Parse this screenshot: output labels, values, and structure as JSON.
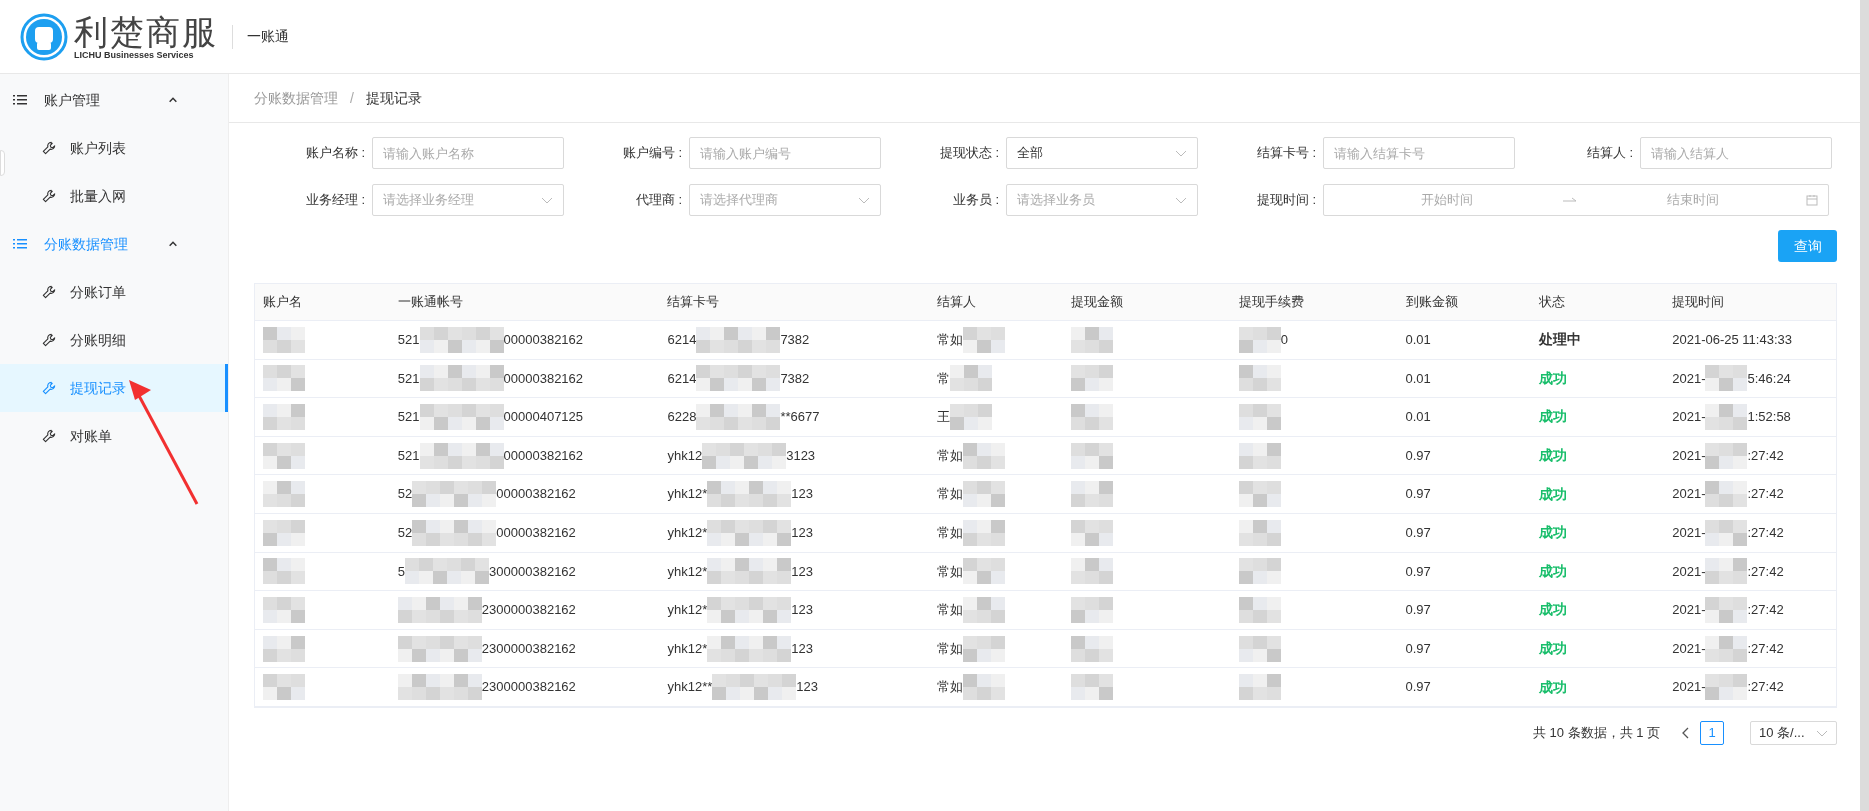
{
  "header": {
    "logo_title": "利楚商服",
    "logo_subtitle": "LICHU Businesses Services",
    "app_name": "一账通"
  },
  "sidebar": {
    "groups": [
      {
        "label": "账户管理",
        "expanded": true,
        "active": false,
        "children": [
          {
            "label": "账户列表",
            "selected": false
          },
          {
            "label": "批量入网",
            "selected": false
          }
        ]
      },
      {
        "label": "分账数据管理",
        "expanded": true,
        "active": true,
        "children": [
          {
            "label": "分账订单",
            "selected": false
          },
          {
            "label": "分账明细",
            "selected": false
          },
          {
            "label": "提现记录",
            "selected": true
          },
          {
            "label": "对账单",
            "selected": false
          }
        ]
      }
    ]
  },
  "breadcrumb": [
    "分账数据管理",
    "提现记录"
  ],
  "breadcrumb_separator": "/",
  "filters": [
    {
      "kind": "input",
      "label": "账户名称 :",
      "placeholder": "请输入账户名称"
    },
    {
      "kind": "input",
      "label": "账户编号 :",
      "placeholder": "请输入账户编号"
    },
    {
      "kind": "select",
      "label": "提现状态 :",
      "value": "全部"
    },
    {
      "kind": "input",
      "label": "结算卡号 :",
      "placeholder": "请输入结算卡号"
    },
    {
      "kind": "input",
      "label": "结算人 :",
      "placeholder": "请输入结算人"
    },
    {
      "kind": "select",
      "label": "业务经理 :",
      "placeholder": "请选择业务经理"
    },
    {
      "kind": "select",
      "label": "代理商 :",
      "placeholder": "请选择代理商"
    },
    {
      "kind": "select",
      "label": "业务员 :",
      "placeholder": "请选择业务员"
    },
    {
      "kind": "daterange",
      "label": "提现时间 :",
      "start_placeholder": "开始时间",
      "end_placeholder": "结束时间"
    }
  ],
  "query_button": "查询",
  "table": {
    "columns": [
      "账户名",
      "一账通帐号",
      "结算卡号",
      "结算人",
      "提现金额",
      "提现手续费",
      "到账金额",
      "状态",
      "提现时间"
    ],
    "rows": [
      [
        {
          "redacted": true
        },
        {
          "text": "521",
          "redacted": true,
          "tail": "00000382162"
        },
        {
          "text": "6214",
          "redacted": true,
          "tail": "7382"
        },
        {
          "text": "常如",
          "redacted": true
        },
        {
          "redacted": true
        },
        {
          "redacted": true,
          "tail": "0"
        },
        {
          "text": "0.01"
        },
        {
          "text": "处理中",
          "color": "#333333"
        },
        {
          "text": "2021-06-25 11:43:33"
        }
      ],
      [
        {
          "redacted": true
        },
        {
          "text": "521",
          "redacted": true,
          "tail": "00000382162"
        },
        {
          "text": "6214",
          "redacted": true,
          "tail": "7382"
        },
        {
          "text": "常",
          "redacted": true
        },
        {
          "redacted": true
        },
        {
          "redacted": true
        },
        {
          "text": "0.01"
        },
        {
          "text": "成功",
          "color": "#19be6b"
        },
        {
          "text": "2021-",
          "redacted": true,
          "tail": "5:46:24"
        }
      ],
      [
        {
          "redacted": true
        },
        {
          "text": "521",
          "redacted": true,
          "tail": "00000407125"
        },
        {
          "text": "6228",
          "redacted": true,
          "tail": "**6677"
        },
        {
          "text": "王",
          "redacted": true
        },
        {
          "redacted": true
        },
        {
          "redacted": true
        },
        {
          "text": "0.01"
        },
        {
          "text": "成功",
          "color": "#19be6b"
        },
        {
          "text": "2021-",
          "redacted": true,
          "tail": "1:52:58"
        }
      ],
      [
        {
          "redacted": true
        },
        {
          "text": "521",
          "redacted": true,
          "tail": "00000382162"
        },
        {
          "text": "yhk12",
          "redacted": true,
          "tail": "3123"
        },
        {
          "text": "常如",
          "redacted": true
        },
        {
          "redacted": true
        },
        {
          "redacted": true
        },
        {
          "text": "0.97"
        },
        {
          "text": "成功",
          "color": "#19be6b"
        },
        {
          "text": "2021-",
          "redacted": true,
          "tail": ":27:42"
        }
      ],
      [
        {
          "redacted": true
        },
        {
          "text": "52",
          "redacted": true,
          "tail": "00000382162"
        },
        {
          "text": "yhk12*",
          "redacted": true,
          "tail": "123"
        },
        {
          "text": "常如",
          "redacted": true
        },
        {
          "redacted": true
        },
        {
          "redacted": true
        },
        {
          "text": "0.97"
        },
        {
          "text": "成功",
          "color": "#19be6b"
        },
        {
          "text": "2021-",
          "redacted": true,
          "tail": ":27:42"
        }
      ],
      [
        {
          "redacted": true
        },
        {
          "text": "52",
          "redacted": true,
          "tail": "00000382162"
        },
        {
          "text": "yhk12*",
          "redacted": true,
          "tail": "123"
        },
        {
          "text": "常如",
          "redacted": true
        },
        {
          "redacted": true
        },
        {
          "redacted": true
        },
        {
          "text": "0.97"
        },
        {
          "text": "成功",
          "color": "#19be6b"
        },
        {
          "text": "2021-",
          "redacted": true,
          "tail": ":27:42"
        }
      ],
      [
        {
          "redacted": true
        },
        {
          "text": "5",
          "redacted": true,
          "tail": "300000382162"
        },
        {
          "text": "yhk12*",
          "redacted": true,
          "tail": "123"
        },
        {
          "text": "常如",
          "redacted": true
        },
        {
          "redacted": true
        },
        {
          "redacted": true
        },
        {
          "text": "0.97"
        },
        {
          "text": "成功",
          "color": "#19be6b"
        },
        {
          "text": "2021-",
          "redacted": true,
          "tail": ":27:42"
        }
      ],
      [
        {
          "redacted": true
        },
        {
          "redacted": true,
          "tail": "2300000382162"
        },
        {
          "text": "yhk12*",
          "redacted": true,
          "tail": "123"
        },
        {
          "text": "常如",
          "redacted": true
        },
        {
          "redacted": true
        },
        {
          "redacted": true
        },
        {
          "text": "0.97"
        },
        {
          "text": "成功",
          "color": "#19be6b"
        },
        {
          "text": "2021-",
          "redacted": true,
          "tail": ":27:42"
        }
      ],
      [
        {
          "redacted": true
        },
        {
          "redacted": true,
          "tail": "2300000382162"
        },
        {
          "text": "yhk12*",
          "redacted": true,
          "tail": "123"
        },
        {
          "text": "常如",
          "redacted": true
        },
        {
          "redacted": true
        },
        {
          "redacted": true
        },
        {
          "text": "0.97"
        },
        {
          "text": "成功",
          "color": "#19be6b"
        },
        {
          "text": "2021-",
          "redacted": true,
          "tail": ":27:42"
        }
      ],
      [
        {
          "redacted": true
        },
        {
          "redacted": true,
          "tail": "2300000382162"
        },
        {
          "text": "yhk12**",
          "redacted": true,
          "tail": "123"
        },
        {
          "text": "常如",
          "redacted": true
        },
        {
          "redacted": true
        },
        {
          "redacted": true
        },
        {
          "text": "0.97"
        },
        {
          "text": "成功",
          "color": "#19be6b"
        },
        {
          "text": "2021-",
          "redacted": true,
          "tail": ":27:42"
        }
      ]
    ]
  },
  "pagination": {
    "summary": "共 10 条数据，共 1 页",
    "current_page": "1",
    "page_size": "10 条/..."
  }
}
